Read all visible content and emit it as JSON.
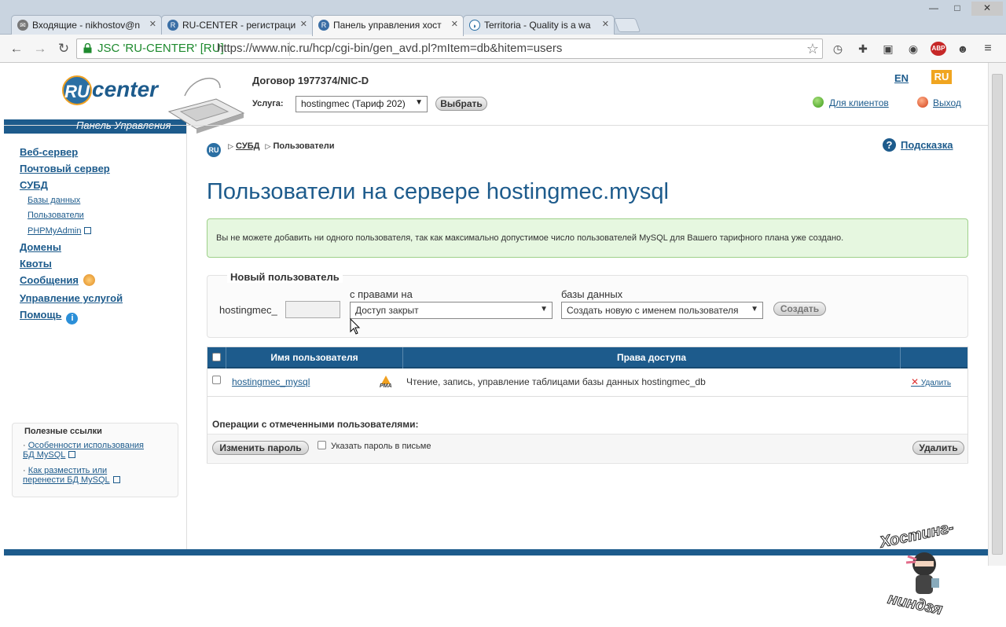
{
  "browser": {
    "tabs": [
      {
        "title": "Входящие - nikhostov@n"
      },
      {
        "title": "RU-CENTER - регистраци"
      },
      {
        "title": "Панель управления хост"
      },
      {
        "title": "Territoria - Quality is a wa"
      }
    ],
    "ev_cert": "JSC 'RU-CENTER' [RU]",
    "url": "https://www.nic.ru/hcp/cgi-bin/gen_avd.pl?mItem=db&hitem=users",
    "ext_abp": "ABP"
  },
  "header": {
    "logo_ru": "RU",
    "logo_center": "center",
    "logo_subtitle": "Панель Управления",
    "contract": "Договор 1977374/NIC-D",
    "service_label": "Услуга:",
    "service_value": "hostingmec (Тариф 202)",
    "select_button": "Выбрать",
    "lang_en": "EN",
    "lang_ru": "RU",
    "clients_link": "Для клиентов",
    "logout_link": "Выход"
  },
  "sidebar": {
    "web_server": "Веб-сервер",
    "mail_server": "Почтовый сервер",
    "dbms": "СУБД",
    "databases": "Базы данных",
    "users": "Пользователи",
    "phpmyadmin": "PHPMyAdmin",
    "domains": "Домены",
    "quotas": "Квоты",
    "messages": "Сообщения",
    "service_mgmt": "Управление услугой",
    "help": "Помощь",
    "useful_title": "Полезные ссылки",
    "useful_link1_line1": "Особенности использования",
    "useful_link1_line2": "БД MySQL",
    "useful_link2_line1": "Как разместить или",
    "useful_link2_line2": "перенести БД MySQL"
  },
  "main": {
    "breadcrumb_icon": "RU",
    "breadcrumb_dbms": "СУБД",
    "breadcrumb_users": "Пользователи",
    "hint": "Подсказка",
    "heading": "Пользователи на сервере hostingmec.mysql",
    "notice": "Вы не можете добавить ни одного пользователя, так как максимально допустимое число пользователей MySQL для Вашего тарифного плана уже создано.",
    "new_user": {
      "title": "Новый пользователь",
      "prefix": "hostingmec_",
      "rights_label": "с правами на",
      "rights_value": "Доступ закрыт",
      "db_label": "базы данных",
      "db_value": "Создать новую с именем пользователя",
      "create_button": "Создать"
    },
    "table": {
      "col_name": "Имя пользователя",
      "col_rights": "Права доступа",
      "rows": [
        {
          "name": "hostingmec_mysql",
          "pma": "PMA",
          "rights": "Чтение, запись, управление таблицами базы данных hostingmec_db",
          "delete": "Удалить"
        }
      ],
      "ops_label": "Операции с отмеченными пользователями:",
      "change_password": "Изменить пароль",
      "send_password_label": "Указать пароль в письме",
      "delete_button": "Удалить"
    }
  },
  "watermark": {
    "top_text": "Хостинг-",
    "bottom_text": "ниндзя"
  }
}
